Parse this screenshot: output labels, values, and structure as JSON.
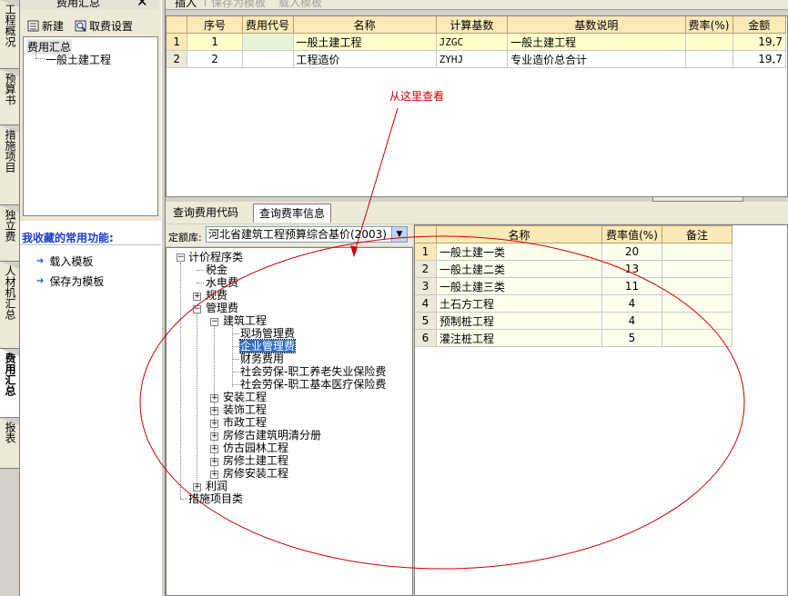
{
  "vertical_tabs": [
    {
      "label": "工程概况",
      "active": false
    },
    {
      "label": "预算书",
      "active": false
    },
    {
      "label": "措施项目",
      "active": false
    },
    {
      "label": "独立费",
      "active": false
    },
    {
      "label": "人材机汇总",
      "active": false
    },
    {
      "label": "费用汇总",
      "active": true
    },
    {
      "label": "报表",
      "active": false
    }
  ],
  "left_panel": {
    "title": "费用汇总",
    "close_glyph": "✕",
    "new_label": "新建",
    "fee_settings_label": "取费设置",
    "tree": {
      "root": "费用汇总",
      "child": "一般土建工程"
    },
    "favorites_title": "我收藏的常用功能:",
    "favorites": [
      "载入模板",
      "保存为模板"
    ]
  },
  "toolbar": {
    "insert": "插入",
    "save_template": "保存为模板",
    "load_template": "载入模板"
  },
  "summary_table": {
    "columns": [
      "序号",
      "费用代号",
      "名称",
      "计算基数",
      "基数说明",
      "费率(%)",
      "金额"
    ],
    "rows": [
      {
        "num": "1",
        "seq": "1",
        "code": "",
        "name": "一般土建工程",
        "base": "JZGC",
        "desc": "一般土建工程",
        "rate": "",
        "amount": "19,7"
      },
      {
        "num": "2",
        "seq": "2",
        "code": "",
        "name": "工程造价",
        "base": "ZYHJ",
        "desc": "专业造价总合计",
        "rate": "",
        "amount": "19,7"
      }
    ]
  },
  "bottom_tabs": [
    "查询费用代码",
    "查询费率信息"
  ],
  "quota": {
    "label": "定额库:",
    "value": "河北省建筑工程预算综合基价(2003)"
  },
  "fee_tree": {
    "root": "计价程序类",
    "tax": "税金",
    "water_power": "水电费",
    "regulatory_fee": "规费",
    "management_fee": "管理费",
    "building": "建筑工程",
    "site_mgmt": "现场管理费",
    "enterprise_mgmt": "企业管理费",
    "finance": "财务费用",
    "social_pension": "社会劳保-职工养老失业保险费",
    "social_medical": "社会劳保-职工基本医疗保险费",
    "install": "安装工程",
    "decoration": "装饰工程",
    "municipal": "市政工程",
    "rehab_ancient": "房修古建筑明清分册",
    "garden": "仿古园林工程",
    "rehab_civil": "房修土建工程",
    "rehab_install": "房修安装工程",
    "profit": "利润",
    "measures": "措施项目类"
  },
  "rate_table": {
    "columns": [
      "名称",
      "费率值(%)",
      "备注"
    ],
    "rows": [
      {
        "num": "1",
        "name": "一般土建一类",
        "rate": "20",
        "note": ""
      },
      {
        "num": "2",
        "name": "一般土建二类",
        "rate": "13",
        "note": ""
      },
      {
        "num": "3",
        "name": "一般土建三类",
        "rate": "11",
        "note": ""
      },
      {
        "num": "4",
        "name": "土石方工程",
        "rate": "4",
        "note": ""
      },
      {
        "num": "5",
        "name": "预制桩工程",
        "rate": "4",
        "note": ""
      },
      {
        "num": "6",
        "name": "灌注桩工程",
        "rate": "5",
        "note": ""
      }
    ]
  },
  "annotation": {
    "text": "从这里查看",
    "color": "#cc0000"
  }
}
